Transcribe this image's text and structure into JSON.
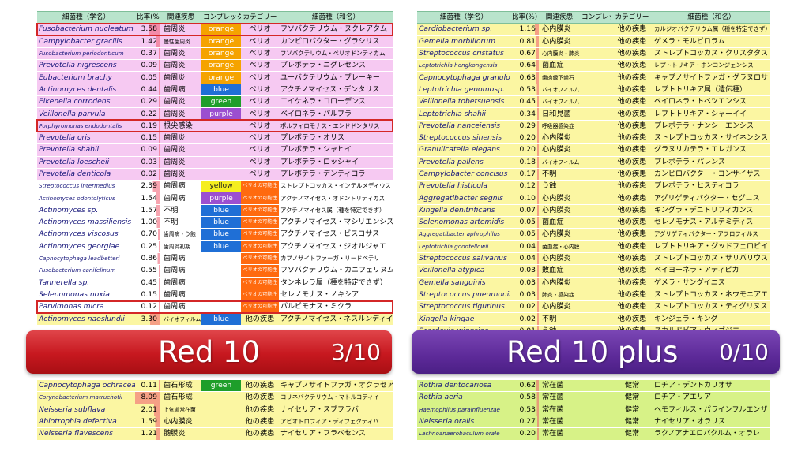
{
  "left_table": {
    "headers": {
      "species": "細菌種（学名）",
      "ratio": "比率(%)",
      "disease": "関連疾患",
      "complex": "コンプレックス",
      "category": "カテゴリー",
      "jp_name": "細菌種（和名）"
    },
    "rows": [
      {
        "species": "Fusobacterium nucleatum",
        "ratio": "3.58",
        "disease": "歯周炎",
        "complex": "orange",
        "category": "ペリオ",
        "jp_name": "フソバクテリウム・ヌクレアタム",
        "boxed": true
      },
      {
        "species": "Campylobacter gracilis",
        "ratio": "1.42",
        "disease": "慢性歯周炎",
        "complex": "orange",
        "category": "ペリオ",
        "jp_name": "カンピロバクター・グラシリス"
      },
      {
        "species": "Fusobacterium periodonticum",
        "ratio": "0.37",
        "disease": "歯周炎",
        "complex": "orange",
        "category": "ペリオ",
        "jp_name": "フソバクテリウム・ペリオドンティカム"
      },
      {
        "species": "Prevotella nigrescens",
        "ratio": "0.09",
        "disease": "歯周炎",
        "complex": "orange",
        "category": "ペリオ",
        "jp_name": "プレボテラ・ニグレセンス"
      },
      {
        "species": "Eubacterium brachy",
        "ratio": "0.05",
        "disease": "歯周炎",
        "complex": "orange",
        "category": "ペリオ",
        "jp_name": "ユーバクテリウム・ブレーキー"
      },
      {
        "species": "Actinomyces dentalis",
        "ratio": "0.44",
        "disease": "歯周病",
        "complex": "blue",
        "category": "ペリオ",
        "jp_name": "アクチノマイセス・デンタリス"
      },
      {
        "species": "Eikenella corrodens",
        "ratio": "0.29",
        "disease": "歯周炎",
        "complex": "green",
        "category": "ペリオ",
        "jp_name": "エイケネラ・コローデンス"
      },
      {
        "species": "Veillonella parvula",
        "ratio": "0.22",
        "disease": "歯周炎",
        "complex": "purple",
        "category": "ペリオ",
        "jp_name": "ベイロネラ・パルブラ"
      },
      {
        "species": "Porphyromonas endodontalis",
        "ratio": "0.19",
        "disease": "根尖感染",
        "complex": "",
        "category": "ペリオ",
        "jp_name": "ポルフィロモナス・エンドドンタリス",
        "boxed": true
      },
      {
        "species": "Prevotella oris",
        "ratio": "0.15",
        "disease": "歯周炎",
        "complex": "",
        "category": "ペリオ",
        "jp_name": "プレボテラ・オリス"
      },
      {
        "species": "Prevotella shahii",
        "ratio": "0.09",
        "disease": "歯周炎",
        "complex": "",
        "category": "ペリオ",
        "jp_name": "プレボテラ・シャヒイ"
      },
      {
        "species": "Prevotella loescheii",
        "ratio": "0.03",
        "disease": "歯周炎",
        "complex": "",
        "category": "ペリオ",
        "jp_name": "プレボテラ・ロッシャイ"
      },
      {
        "species": "Prevotella denticola",
        "ratio": "0.02",
        "disease": "歯周炎",
        "complex": "",
        "category": "ペリオ",
        "jp_name": "プレボテラ・デンティコラ"
      },
      {
        "species": "Streptococcus intermedius",
        "ratio": "2.39",
        "disease": "歯周病",
        "complex": "yellow",
        "category": "ペリオの可能性",
        "jp_name": "ストレプトコッカス・インテルメディウス"
      },
      {
        "species": "Actinomyces odontolyticus",
        "ratio": "1.54",
        "disease": "歯周病",
        "complex": "purple",
        "category": "ペリオの可能性",
        "jp_name": "アクチノマイセス・オドントリティカス"
      },
      {
        "species": "Actinomyces sp.",
        "ratio": "1.57",
        "disease": "不明",
        "complex": "blue",
        "category": "ペリオの可能性",
        "jp_name": "アクチノマイセス属（種を特定できず）"
      },
      {
        "species": "Actinomyces massiliensis",
        "ratio": "1.00",
        "disease": "不明",
        "complex": "blue",
        "category": "ペリオの可能性",
        "jp_name": "アクチノマイセス・マシリエンシス"
      },
      {
        "species": "Actinomyces viscosus",
        "ratio": "0.70",
        "disease": "歯周病・う蝕",
        "complex": "blue",
        "category": "ペリオの可能性",
        "jp_name": "アクチノマイセス・ビスコサス"
      },
      {
        "species": "Actinomyces georgiae",
        "ratio": "0.25",
        "disease": "歯周炎初期",
        "complex": "blue",
        "category": "ペリオの可能性",
        "jp_name": "アクチノマイセス・ジオルジャエ"
      },
      {
        "species": "Capnocytophaga leadbetteri",
        "ratio": "0.86",
        "disease": "歯周病",
        "complex": "",
        "category": "ペリオの可能性",
        "jp_name": "カプノサイトファーガ・リードベテリ"
      },
      {
        "species": "Fusobacterium canifelinum",
        "ratio": "0.55",
        "disease": "歯周病",
        "complex": "",
        "category": "ペリオの可能性",
        "jp_name": "フソバクテリウム・カニフェリヌム"
      },
      {
        "species": "Tannerella sp.",
        "ratio": "0.45",
        "disease": "歯周病",
        "complex": "",
        "category": "ペリオの可能性",
        "jp_name": "タンネレラ属（種を特定できず）"
      },
      {
        "species": "Selenomonas noxia",
        "ratio": "0.15",
        "disease": "歯周病",
        "complex": "",
        "category": "ペリオの可能性",
        "jp_name": "セレノモナス・ノキシア"
      },
      {
        "species": "Parvimonas micra",
        "ratio": "0.12",
        "disease": "歯周病",
        "complex": "",
        "category": "ペリオの可能性",
        "jp_name": "パルビモナス・ミクラ",
        "boxed": true
      },
      {
        "species": "Actinomyces naeslundii",
        "ratio": "3.30",
        "disease": "バイオフィルム形成",
        "complex": "blue",
        "category": "他の疾患",
        "jp_name": "アクチノマイセス・ネスルンディイ"
      }
    ],
    "bottom_rows": [
      {
        "species": "Capnocytophaga ochracea",
        "ratio": "0.11",
        "disease": "歯石形成",
        "complex": "green",
        "category": "他の疾患",
        "jp_name": "キャプノサイトファガ・オクラセア"
      },
      {
        "species": "Corynebacterium matruchotii",
        "ratio": "8.09",
        "disease": "歯石形成",
        "complex": "",
        "category": "他の疾患",
        "jp_name": "コリネバクテリウム・マトルコティイ"
      },
      {
        "species": "Neisseria subflava",
        "ratio": "2.01",
        "disease": "上気道常在菌",
        "complex": "",
        "category": "他の疾患",
        "jp_name": "ナイセリア・スブフラバ"
      },
      {
        "species": "Abiotrophia defectiva",
        "ratio": "1.59",
        "disease": "心内膜炎",
        "complex": "",
        "category": "他の疾患",
        "jp_name": "アビオトロフィア・ディフェクティバ"
      },
      {
        "species": "Neisseria flavescens",
        "ratio": "1.21",
        "disease": "髄膜炎",
        "complex": "",
        "category": "他の疾患",
        "jp_name": "ナイセリア・フラベセンス"
      }
    ]
  },
  "right_table": {
    "headers": {
      "species": "細菌種（学名）",
      "ratio": "比率(%)",
      "disease": "関連疾患",
      "complex": "コンプレックス",
      "category": "カテゴリー",
      "jp_name": "細菌種（和名）"
    },
    "rows": [
      {
        "species": "Cardiobacterium sp.",
        "ratio": "1.16",
        "disease": "心内膜炎",
        "category": "他の疾患",
        "jp_name": "カルジオバクテリウム属（種を特定できず）"
      },
      {
        "species": "Gemella morbillorum",
        "ratio": "0.81",
        "disease": "心内膜炎",
        "category": "他の疾患",
        "jp_name": "ゲメラ・モルビロラム"
      },
      {
        "species": "Streptococcus cristatus",
        "ratio": "0.67",
        "disease": "心内膜炎・肺炎",
        "category": "他の疾患",
        "jp_name": "ストレプトコッカス・クリスタタス"
      },
      {
        "species": "Leptotrichia hongkongensis",
        "ratio": "0.64",
        "disease": "菌血症",
        "category": "他の疾患",
        "jp_name": "レプトトリキア・ホンコンジェンシス"
      },
      {
        "species": "Capnocytophaga granulosa",
        "ratio": "0.63",
        "disease": "歯肉縁下歯石",
        "category": "他の疾患",
        "jp_name": "キャプノサイトファガ・グラヌロサ"
      },
      {
        "species": "Leptotrichia genomosp.",
        "ratio": "0.53",
        "disease": "バイオフィルム",
        "category": "他の疾患",
        "jp_name": "レプトトリキア属（遺伝種）"
      },
      {
        "species": "Veillonella tobetsuensis",
        "ratio": "0.45",
        "disease": "バイオフィルム",
        "category": "他の疾患",
        "jp_name": "ベイロネラ・トベツエンシス"
      },
      {
        "species": "Leptotrichia shahii",
        "ratio": "0.34",
        "disease": "日和見菌",
        "category": "他の疾患",
        "jp_name": "レプトトリキア・シャーイイ"
      },
      {
        "species": "Prevotella nanceiensis",
        "ratio": "0.29",
        "disease": "呼吸器感染症",
        "category": "他の疾患",
        "jp_name": "プレボテラ・ナンシーエンシス"
      },
      {
        "species": "Streptococcus sinensis",
        "ratio": "0.20",
        "disease": "心内膜炎",
        "category": "他の疾患",
        "jp_name": "ストレプトコッカス・サイネンシス"
      },
      {
        "species": "Granulicatella elegans",
        "ratio": "0.20",
        "disease": "心内膜炎",
        "category": "他の疾患",
        "jp_name": "グラヌリカテラ・エレガンス"
      },
      {
        "species": "Prevotella pallens",
        "ratio": "0.18",
        "disease": "バイオフィルム",
        "category": "他の疾患",
        "jp_name": "プレボテラ・パレンス"
      },
      {
        "species": "Campylobacter concisus",
        "ratio": "0.17",
        "disease": "不明",
        "category": "他の疾患",
        "jp_name": "カンピロバクター・コンサイサス"
      },
      {
        "species": "Prevotella histicola",
        "ratio": "0.12",
        "disease": "う蝕",
        "category": "他の疾患",
        "jp_name": "プレボテラ・ヒスティコラ"
      },
      {
        "species": "Aggregatibacter segnis",
        "ratio": "0.10",
        "disease": "心内膜炎",
        "category": "他の疾患",
        "jp_name": "アグリゲティバクター・セグニス"
      },
      {
        "species": "Kingella denitrificans",
        "ratio": "0.07",
        "disease": "心内膜炎",
        "category": "他の疾患",
        "jp_name": "キングラ・デニトリフィカンス"
      },
      {
        "species": "Selenomonas artemidis",
        "ratio": "0.05",
        "disease": "菌血症",
        "category": "他の疾患",
        "jp_name": "セレノモナス・アルテミディス"
      },
      {
        "species": "Aggregatibacter aphrophilus",
        "ratio": "0.05",
        "disease": "心内膜炎",
        "category": "他の疾患",
        "jp_name": "アグリゲティバクター・アフロフィルス"
      },
      {
        "species": "Leptotrichia goodfellowii",
        "ratio": "0.04",
        "disease": "菌血症・心内膜炎",
        "category": "他の疾患",
        "jp_name": "レプトトリキア・グッドフェロビイ"
      },
      {
        "species": "Streptococcus salivarius",
        "ratio": "0.04",
        "disease": "心内膜炎",
        "category": "他の疾患",
        "jp_name": "ストレプトコッカス・サリバリウス"
      },
      {
        "species": "Veillonella atypica",
        "ratio": "0.03",
        "disease": "敗血症",
        "category": "他の疾患",
        "jp_name": "ベイヨーネラ・アティピカ"
      },
      {
        "species": "Gemella sanguinis",
        "ratio": "0.03",
        "disease": "心内膜炎",
        "category": "他の疾患",
        "jp_name": "ゲメラ・サングイニス"
      },
      {
        "species": "Streptococcus pneumoniae",
        "ratio": "0.03",
        "disease": "肺炎・感染症",
        "category": "他の疾患",
        "jp_name": "ストレプトコッカス・ネウモニアエ"
      },
      {
        "species": "Streptococcus tigurinus",
        "ratio": "0.02",
        "disease": "心内膜炎",
        "category": "他の疾患",
        "jp_name": "ストレプトコッカス・ティグリヌス"
      },
      {
        "species": "Kingella kingae",
        "ratio": "0.02",
        "disease": "不明",
        "category": "他の疾患",
        "jp_name": "キンジェラ・キング"
      },
      {
        "species": "Scardovia wiggsiae",
        "ratio": "0.01",
        "disease": "う蝕",
        "category": "他の疾患",
        "jp_name": "スカルドビア・ウィゴジエ"
      }
    ],
    "bottom_rows": [
      {
        "species": "Rothia dentocariosa",
        "ratio": "0.62",
        "disease": "常在菌",
        "category": "健常",
        "jp_name": "ロチア・デントカリオサ"
      },
      {
        "species": "Rothia aeria",
        "ratio": "0.58",
        "disease": "常在菌",
        "category": "健常",
        "jp_name": "ロチア・アエリア"
      },
      {
        "species": "Haemophilus parainfluenzae",
        "ratio": "0.53",
        "disease": "常在菌",
        "category": "健常",
        "jp_name": "ヘモフィルス・パラインフルエンザ"
      },
      {
        "species": "Neisseria oralis",
        "ratio": "0.27",
        "disease": "常在菌",
        "category": "健常",
        "jp_name": "ナイセリア・オラリス"
      },
      {
        "species": "Lachnoanaerobaculum orale",
        "ratio": "0.20",
        "disease": "常在菌",
        "category": "健常",
        "jp_name": "ラクノアナエロバクルム・オラレ"
      }
    ]
  },
  "banners": {
    "left": {
      "title": "Red 10",
      "score": "3/10"
    },
    "right": {
      "title": "Red 10 plus",
      "score": "0/10"
    }
  },
  "colors": {
    "pink": "#f6c9f2",
    "white": "#ffffff",
    "yellow": "#fbf6a2",
    "lime": "#d7f287",
    "orange_complex": "#f5a300",
    "blue_complex": "#1f6fd6",
    "green_complex": "#1e9e2a",
    "purple_complex": "#9b4fd0",
    "yellow_complex": "#f5ee1e",
    "orange_category": "#ff6a0f",
    "header": "#b9e4cc",
    "red_box": "#d42727"
  }
}
